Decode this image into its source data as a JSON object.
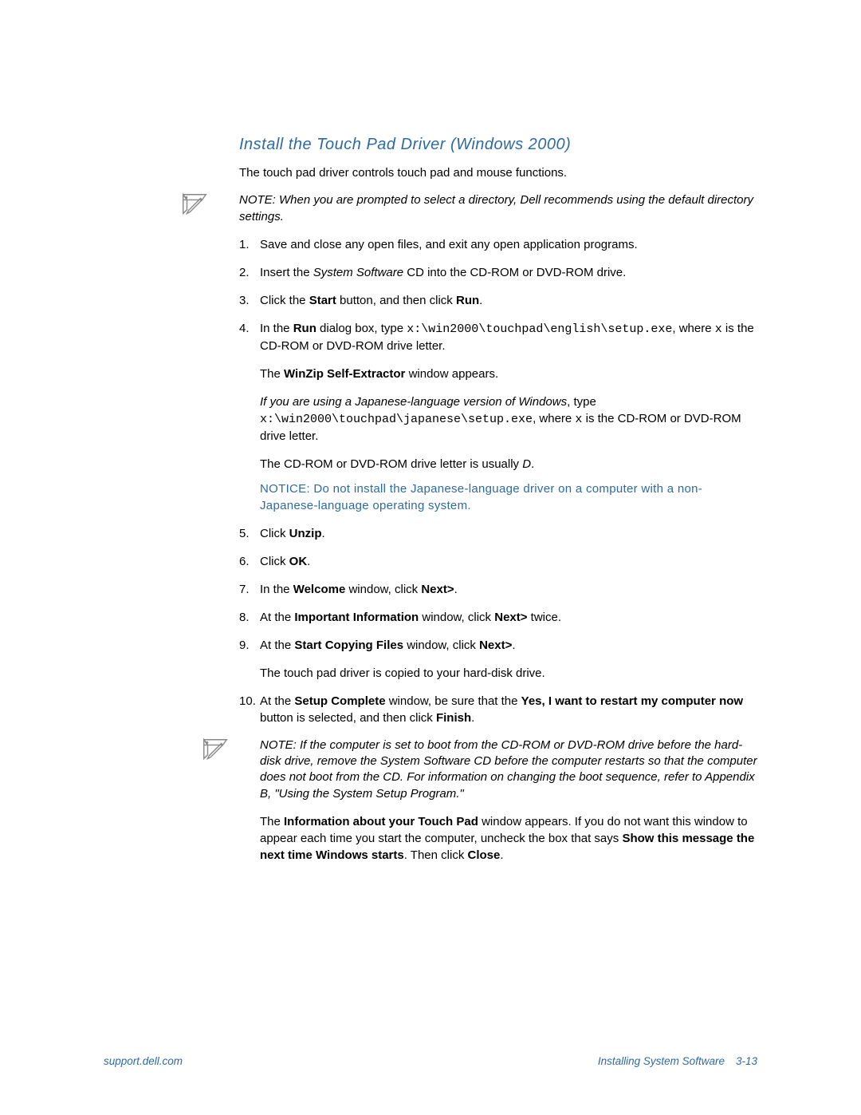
{
  "heading": "Install the Touch Pad Driver (Windows 2000)",
  "intro": "The touch pad driver controls touch pad and mouse functions.",
  "note1": {
    "prefix": "NOTE: When you are prompted to select a directory, Dell recommends using the default directory settings."
  },
  "steps": {
    "s1": "Save and close any open files, and exit any open application programs.",
    "s2": {
      "a": "Insert the ",
      "cd_i": "System Software",
      "b": " CD into the CD-ROM or DVD-ROM drive."
    },
    "s3": {
      "a": "Click the ",
      "start_b": "Start",
      "b": " button, and then click ",
      "run_b": "Run",
      "c": "."
    },
    "s4": {
      "a": "In the ",
      "run_b": "Run",
      "b": " dialog box, type ",
      "path_mono": "x:\\win2000\\touchpad\\english\\setup.exe",
      "c": ", where ",
      "x_mono": "x",
      "d": " is the CD-ROM or DVD-ROM drive letter.",
      "sub1": {
        "a": "The ",
        "winzip_b": "WinZip Self-Extractor",
        "b": " window appears."
      },
      "sub2": {
        "jp_i": "If you are using a Japanese-language version of Windows",
        "a": ", type ",
        "path_mono": "x:\\win2000\\touchpad\\japanese\\setup.exe",
        "b": ", where ",
        "x_mono": "x",
        "c": " is the CD-ROM or DVD-ROM drive letter."
      },
      "sub3": {
        "a": "The CD-ROM or DVD-ROM drive letter is usually ",
        "d_i": "D",
        "b": "."
      },
      "notice": "NOTICE: Do not install the Japanese-language driver on a computer with a non-Japanese-language operating system."
    },
    "s5": {
      "a": "Click ",
      "unzip_b": "Unzip",
      "b": "."
    },
    "s6": {
      "a": "Click ",
      "ok_b": "OK",
      "b": "."
    },
    "s7": {
      "a": "In the ",
      "welcome_b": "Welcome",
      "b": " window, click ",
      "next_b": "Next>",
      "c": "."
    },
    "s8": {
      "a": "At the ",
      "info_b": "Important Information",
      "b": " window, click ",
      "next_b": "Next>",
      "c": " twice."
    },
    "s9": {
      "a": "At the ",
      "copy_b": "Start Copying Files",
      "b": " window, click ",
      "next_b": "Next>",
      "c": ".",
      "sub": "The touch pad driver is copied to your hard-disk drive."
    },
    "s10": {
      "a": "At the ",
      "setup_b": "Setup Complete",
      "b": " window, be sure that the ",
      "restart_b": "Yes, I want to restart my computer now",
      "c": " button is selected, and then click ",
      "finish_b": "Finish",
      "d": "."
    }
  },
  "note2": {
    "text": "NOTE: If the computer is set to boot from the CD-ROM or DVD-ROM drive before the hard-disk drive, remove the System Software CD before the computer restarts so that the computer does not boot from the CD. For information on changing the boot sequence, refer to Appendix B, \"Using the System Setup Program.\""
  },
  "trailing": {
    "a": "The ",
    "info_b": "Information about your Touch Pad",
    "b": " window appears. If you do not want this window to appear each time you start the computer, uncheck the box that says ",
    "show_b": "Show this message the next time Windows starts",
    "c": ". Then click ",
    "close_b": "Close",
    "d": "."
  },
  "footer": {
    "left": "support.dell.com",
    "right_title": "Installing System Software",
    "right_page": "3-13"
  }
}
